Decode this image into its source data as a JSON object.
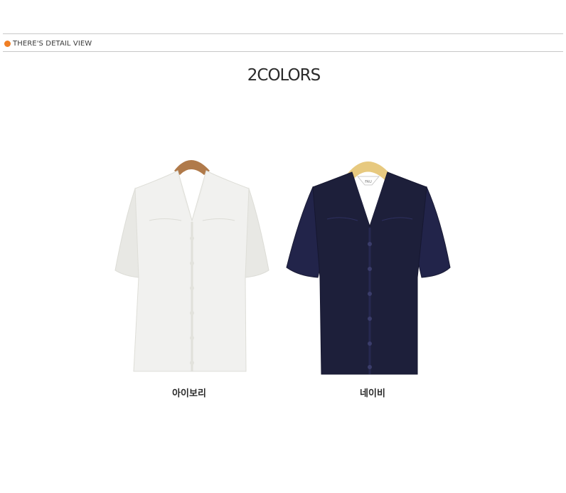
{
  "detail_section": {
    "label": "THERE'S DETAIL VIEW",
    "dot_color": "#f07f24"
  },
  "title": "2COLORS",
  "products": [
    {
      "color_name": "아이보리",
      "image_icon": "ivory-blouse-image",
      "swatch": "#f1f1ef"
    },
    {
      "color_name": "네이비",
      "image_icon": "navy-blouse-image",
      "swatch": "#1d1f3a"
    }
  ],
  "label_tag": "FAU"
}
